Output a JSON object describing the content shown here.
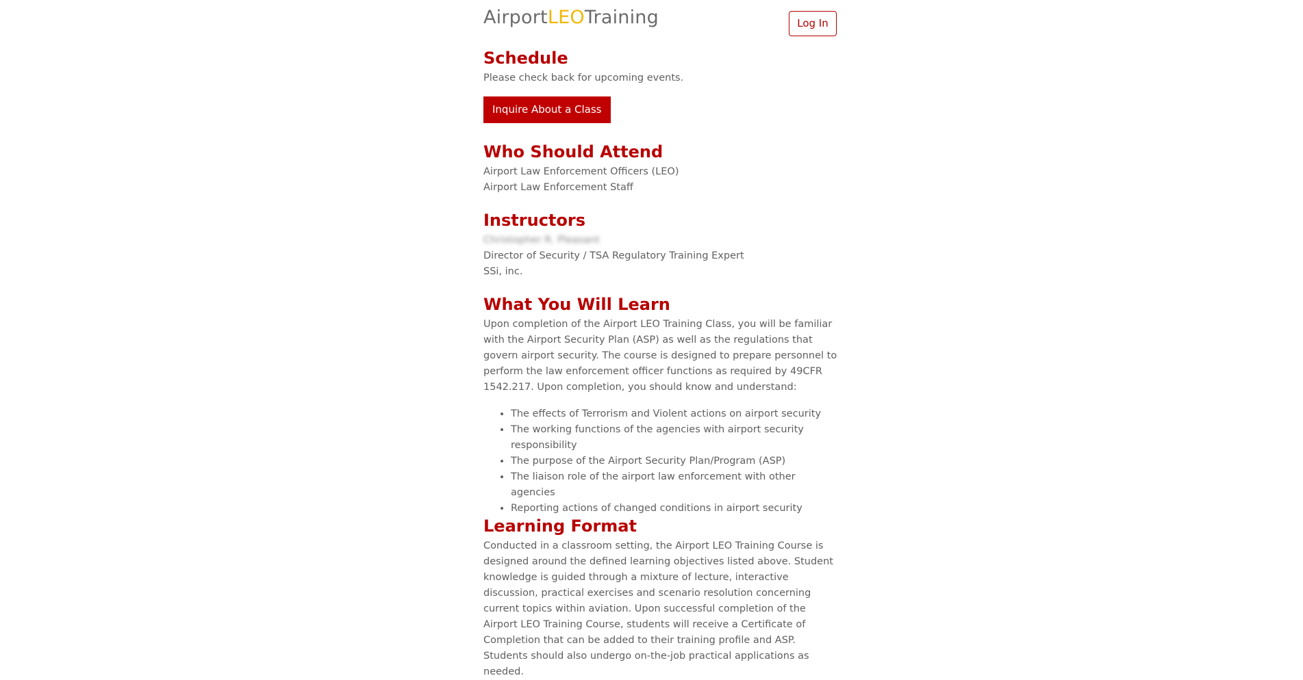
{
  "header": {
    "logo": {
      "part1": "Airport",
      "part2": "LEO",
      "part3": "Training"
    },
    "login_label": "Log In"
  },
  "schedule": {
    "title": "Schedule",
    "text": "Please check back for upcoming events.",
    "button_label": "Inquire About a Class"
  },
  "attend": {
    "title": "Who Should Attend",
    "items": [
      "Airport Law Enforcement Officers (LEO)",
      "Airport Law Enforcement Staff"
    ]
  },
  "instructors": {
    "title": "Instructors",
    "name": "Christopher R. Pleasant",
    "role": "Director of Security / TSA Regulatory Training Expert",
    "company": "SSi, inc."
  },
  "learn": {
    "title": "What You Will Learn",
    "intro": "Upon completion of the Airport LEO Training Class, you will be familiar with the Airport Security Plan (ASP) as well as the regulations that govern airport security. The course is designed to prepare personnel to perform the law enforcement officer functions as required by 49CFR 1542.217. Upon completion, you should know and understand:",
    "bullets": [
      "The effects of Terrorism and Violent actions on airport security",
      "The working functions of the agencies with airport security responsibility",
      "The purpose of the Airport Security Plan/Program (ASP)",
      "The liaison role of the airport law enforcement with other agencies",
      "Reporting actions of changed conditions in airport security"
    ]
  },
  "format": {
    "title": "Learning Format",
    "text": "Conducted in a classroom setting, the Airport LEO Training Course is designed around the defined learning objectives listed above. Student knowledge is guided through a mixture of lecture, interactive discussion, practical exercises and scenario resolution concerning current topics within aviation. Upon successful completion of the Airport LEO Training Course, students will receive a Certificate of Completion that can be added to their training profile and ASP. Students should also undergo on-the-job practical applications as needed."
  },
  "colors": {
    "accent": "#c00000",
    "logo_highlight": "#f2b705",
    "text": "#5f5f5f"
  }
}
